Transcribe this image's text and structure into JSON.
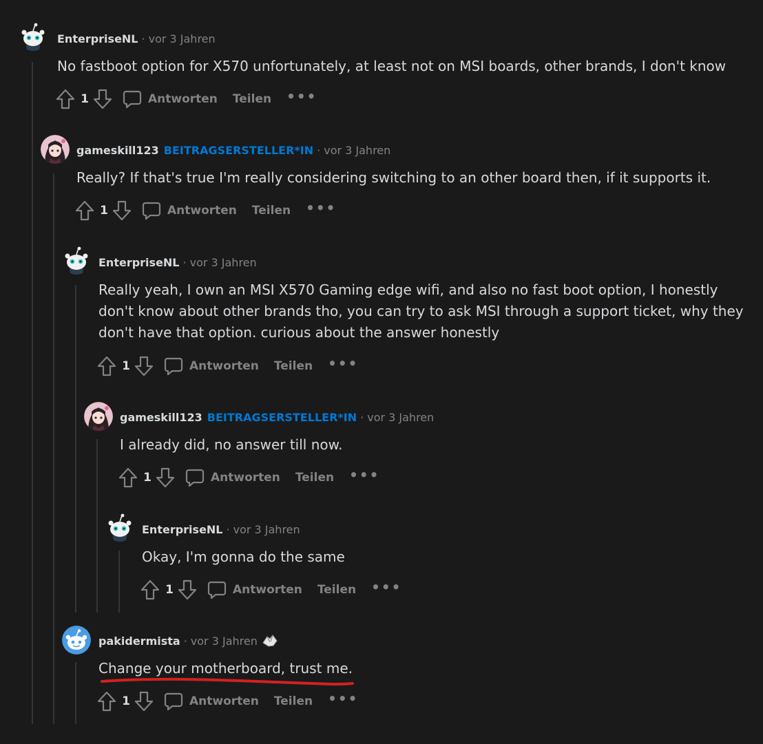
{
  "icons": {
    "upvote": "upvote-arrow-icon",
    "downvote": "downvote-arrow-icon",
    "reply": "comment-bubble-icon",
    "more": "more-options-icon",
    "award": "helping-hands-award-icon"
  },
  "colors": {
    "background": "#1a1a1b",
    "op_badge": "#0079d3",
    "muted": "#818384",
    "text": "#d7dadc",
    "highlight_underline": "#d42020"
  },
  "labels": {
    "reply": "Antworten",
    "share": "Teilen",
    "more": "•••",
    "separator": "·"
  },
  "comments": [
    {
      "author": "EnterpriseNL",
      "badge": "",
      "time": "vor 3 Jahren",
      "score": "1",
      "text": [
        "No fastboot option for X570 unfortunately, at least not on MSI boards, other brands, I don't know"
      ]
    },
    {
      "author": "gameskill123",
      "badge": "BEITRAGSERSTELLER*IN",
      "time": "vor 3 Jahren",
      "score": "1",
      "text": [
        "Really? If that's true I'm really considering switching to an other board then, if it supports it."
      ]
    },
    {
      "author": "EnterpriseNL",
      "badge": "",
      "time": "vor 3 Jahren",
      "score": "1",
      "text": [
        "Really yeah, I own an MSI X570 Gaming edge wifi, and also no fast boot option, I honestly",
        "don't know about other brands tho, you can try to ask MSI through a support ticket, why they",
        "don't have that option. curious about the answer honestly"
      ]
    },
    {
      "author": "gameskill123",
      "badge": "BEITRAGSERSTELLER*IN",
      "time": "vor 3 Jahren",
      "score": "1",
      "text": [
        "I already did, no answer till now."
      ]
    },
    {
      "author": "EnterpriseNL",
      "badge": "",
      "time": "vor 3 Jahren",
      "score": "1",
      "text": [
        "Okay, I'm gonna do the same"
      ]
    },
    {
      "author": "pakidermista",
      "badge": "",
      "time": "vor 3 Jahren",
      "score": "1",
      "has_award": true,
      "text": [
        "Change your motherboard, trust me."
      ]
    }
  ]
}
